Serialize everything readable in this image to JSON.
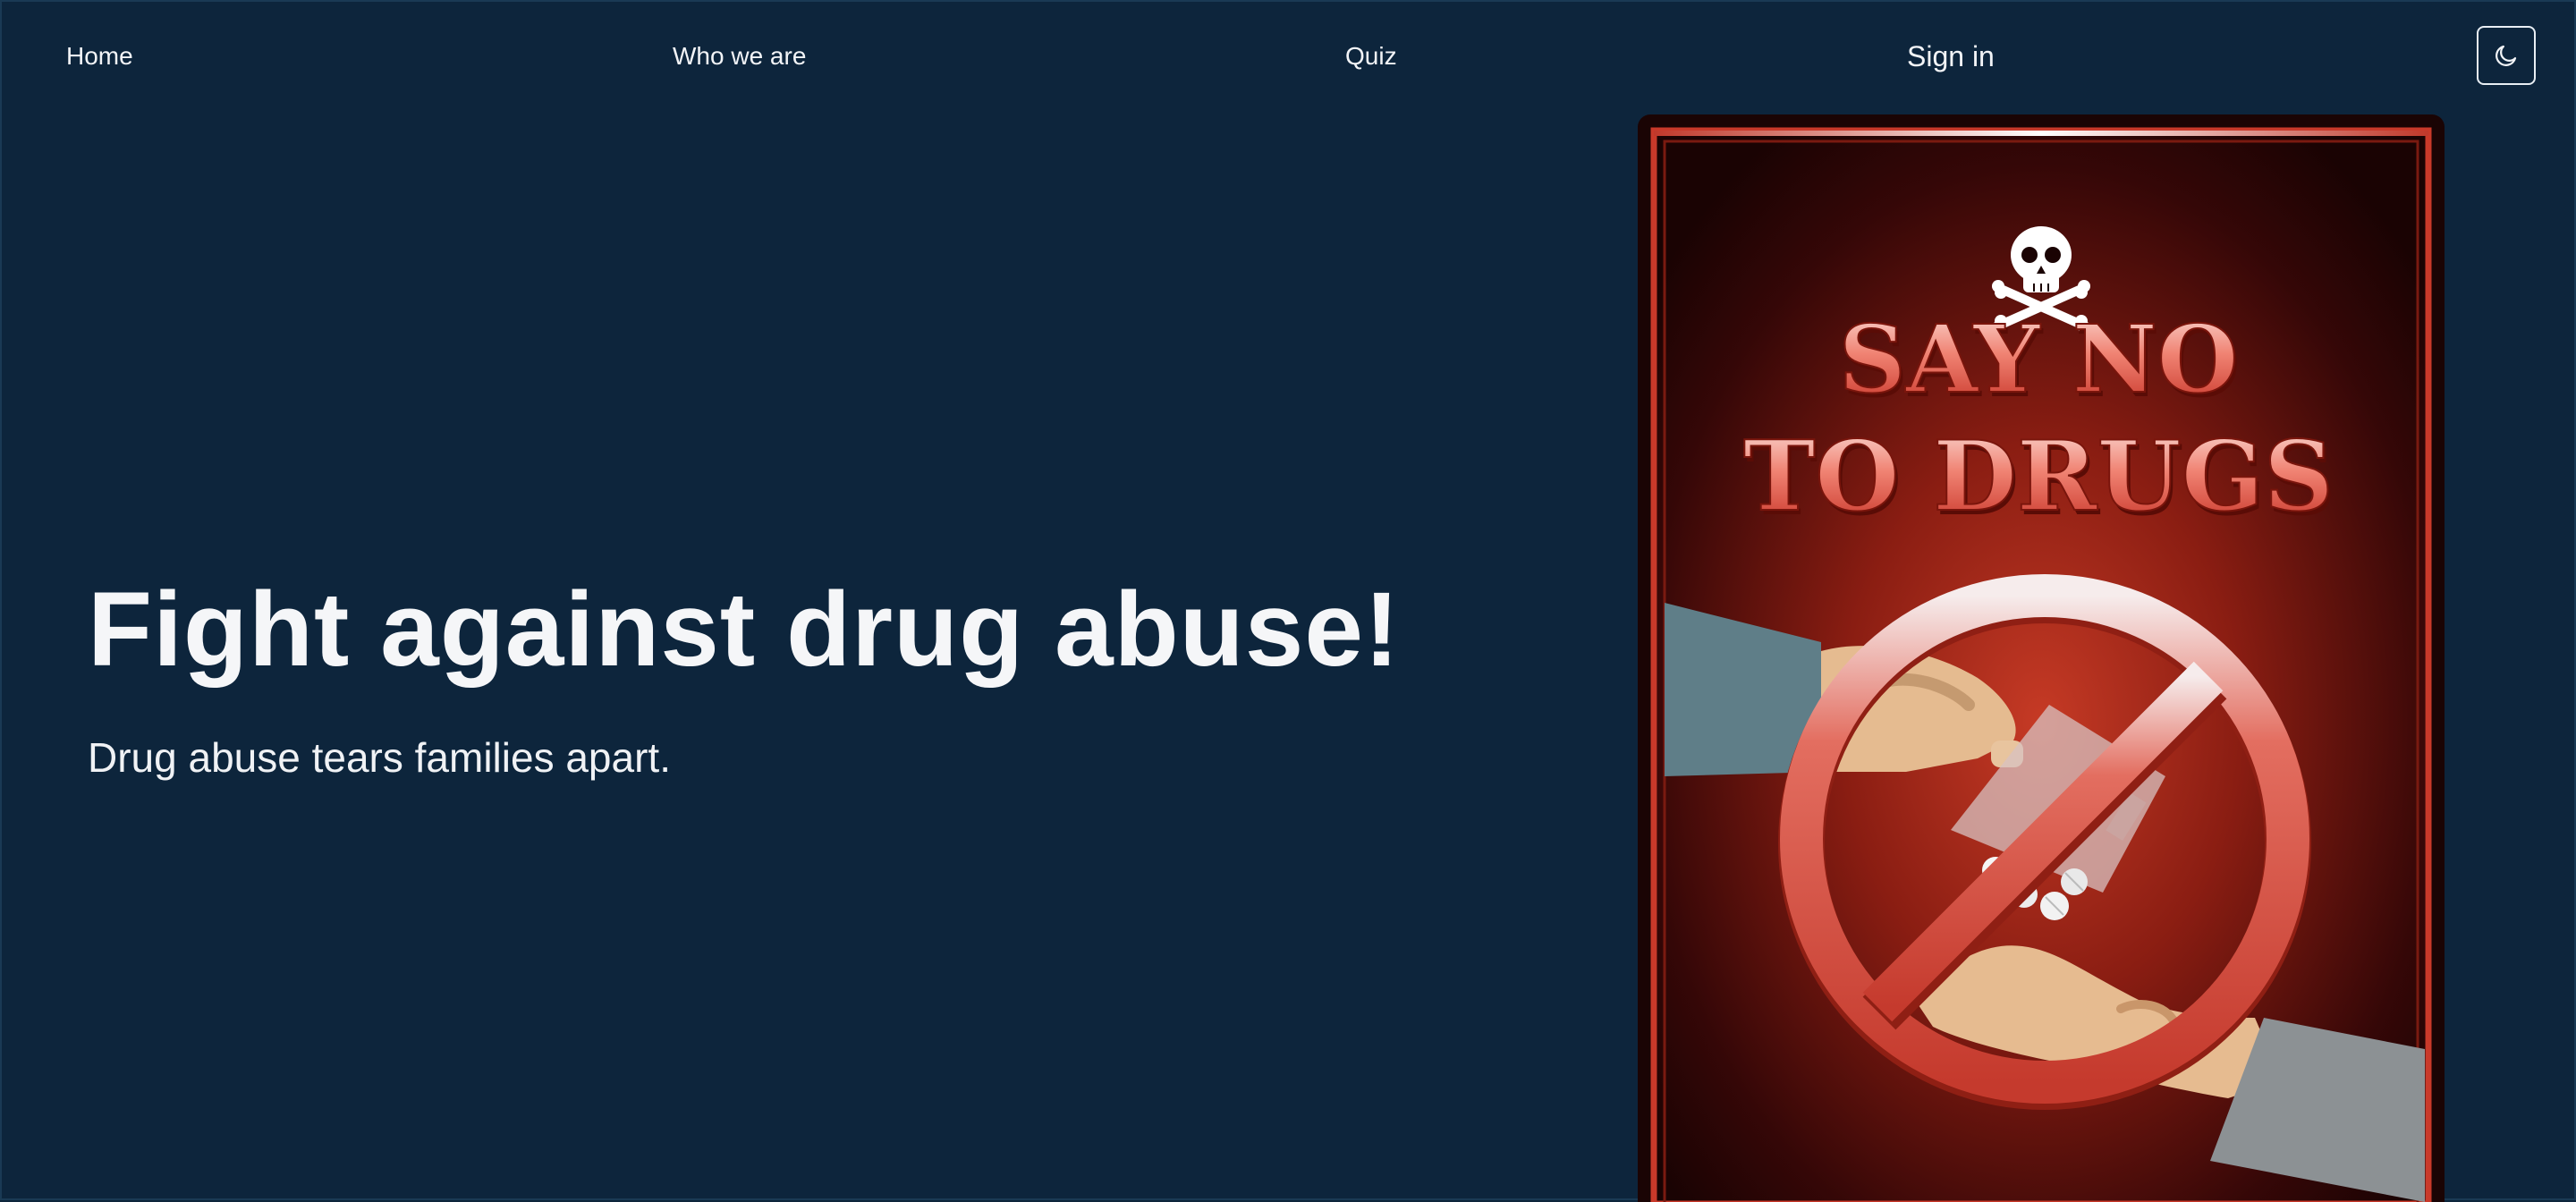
{
  "nav": {
    "home": "Home",
    "who_we_are": "Who we are",
    "quiz": "Quiz",
    "sign_in": "Sign in",
    "theme_toggle_icon": "moon-icon"
  },
  "hero": {
    "title": "Fight against drug abuse!",
    "subtitle": "Drug abuse tears families apart."
  },
  "poster": {
    "line1": "SAY NO",
    "line2": "TO DRUGS",
    "icons": [
      "skull-crossbones-icon",
      "prohibition-sign-icon",
      "pills-icon",
      "hands-icon"
    ]
  },
  "colors": {
    "background": "#0d253c",
    "text": "#f2f4f7",
    "poster_red": "#c0392b",
    "poster_dark": "#1a0303"
  }
}
